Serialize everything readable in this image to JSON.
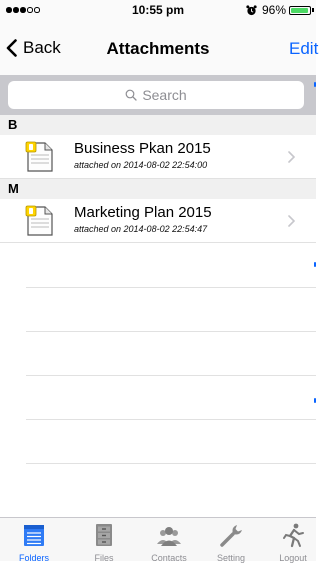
{
  "status_bar": {
    "time": "10:55 pm",
    "battery": "96%",
    "signal_dots_filled": 3,
    "signal_dots_total": 5,
    "battery_level": 0.96,
    "battery_color": "#4cd964"
  },
  "nav": {
    "back_label": "Back",
    "title": "Attachments",
    "edit_label": "Edit",
    "accent_color": "#0a64ff"
  },
  "search": {
    "placeholder": "Search",
    "icon": "search-icon"
  },
  "sections": [
    {
      "letter": "B",
      "items": [
        {
          "title": "Business Pkan 2015",
          "subtitle": "attached on 2014-08-02 22:54:00",
          "icon": "document-icon"
        }
      ]
    },
    {
      "letter": "M",
      "items": [
        {
          "title": "Marketing Plan 2015",
          "subtitle": "attached on 2014-08-02 22:54:47",
          "icon": "document-icon"
        }
      ]
    }
  ],
  "tabs": [
    {
      "label": "Folders",
      "icon": "folders-icon",
      "active": true
    },
    {
      "label": "Files",
      "icon": "files-cabinet-icon",
      "active": false
    },
    {
      "label": "Contacts",
      "icon": "contacts-icon",
      "active": false
    },
    {
      "label": "Setting",
      "icon": "wrench-icon",
      "active": false
    },
    {
      "label": "Logout",
      "icon": "running-man-icon",
      "active": false
    }
  ]
}
